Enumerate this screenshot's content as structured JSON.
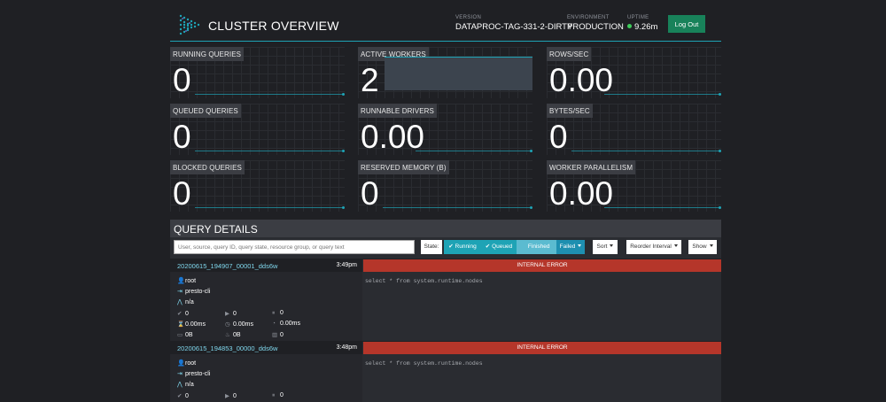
{
  "header": {
    "title": "CLUSTER OVERVIEW",
    "version_label": "VERSION",
    "version": "DATAPROC-TAG-331-2-DIRTY",
    "environment_label": "ENVIRONMENT",
    "environment": "PRODUCTION",
    "uptime_label": "UPTIME",
    "uptime": "9.26m",
    "logout_label": "Log Out"
  },
  "tiles": [
    {
      "label": "RUNNING QUERIES",
      "value": "0"
    },
    {
      "label": "ACTIVE WORKERS",
      "value": "2"
    },
    {
      "label": "ROWS/SEC",
      "value": "0.00"
    },
    {
      "label": "QUEUED QUERIES",
      "value": "0"
    },
    {
      "label": "RUNNABLE DRIVERS",
      "value": "0.00"
    },
    {
      "label": "BYTES/SEC",
      "value": "0"
    },
    {
      "label": "BLOCKED QUERIES",
      "value": "0"
    },
    {
      "label": "RESERVED MEMORY (B)",
      "value": "0"
    },
    {
      "label": "WORKER PARALLELISM",
      "value": "0.00"
    }
  ],
  "query_details": {
    "title": "QUERY DETAILS",
    "search_placeholder": "User, source, query ID, query state, resource group, or query text",
    "state_label": "State:",
    "filters": {
      "running": "Running",
      "queued": "Queued",
      "finished": "Finished",
      "failed": "Failed"
    },
    "sort_label": "Sort",
    "reorder_label": "Reorder Interval",
    "show_label": "Show"
  },
  "queries": [
    {
      "id": "20200615_194907_00001_dds6w",
      "time": "3:49pm",
      "user": "root",
      "source": "presto-cli",
      "resource_group": "n/a",
      "completed": "0",
      "running": "0",
      "queued": "0",
      "elapsed": "0.00ms",
      "cpu": "0.00ms",
      "execution": "0.00ms",
      "memory": "0B",
      "peak_memory": "0B",
      "cumulative": "0",
      "state": "INTERNAL ERROR",
      "sql": "select * from system.runtime.nodes"
    },
    {
      "id": "20200615_194853_00000_dds6w",
      "time": "3:48pm",
      "user": "root",
      "source": "presto-cli",
      "resource_group": "n/a",
      "completed": "0",
      "running": "0",
      "queued": "0",
      "state": "INTERNAL ERROR",
      "sql": "select * from system.runtime.nodes"
    }
  ]
}
